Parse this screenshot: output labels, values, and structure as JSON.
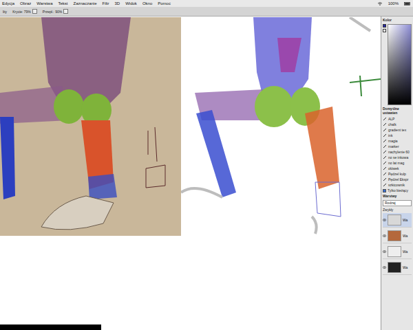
{
  "menu": [
    "Edycja",
    "Obraz",
    "Warstwa",
    "Tekst",
    "Zaznaczanie",
    "Filtr",
    "3D",
    "Widok",
    "Okno",
    "Pomoc"
  ],
  "status": {
    "zoom": "100%"
  },
  "options": {
    "mode": "lity",
    "opacity": "Krycie: 79%",
    "flow": "Przepł.: 90%"
  },
  "panel": {
    "color_title": "Kolor",
    "brush_title": "Domyślne ustawien",
    "brushes": [
      "ALP",
      "chalk",
      "gradient tex",
      "ink",
      "magia",
      "marker",
      "nachylenie 60",
      "no se inkowa",
      "no lat mag",
      "ołówek",
      "Pędzel kulp",
      "Pędzel Ekspr",
      "szkicownik"
    ],
    "current_tool_only": {
      "label": "Tylko bieżący",
      "checked": true
    },
    "layers_title": "Warstwy",
    "search": {
      "placeholder": "Rodzaj"
    },
    "blend": "Zwykły",
    "layers": [
      {
        "name": "Wa",
        "selected": true,
        "thumb": "#d8d8d8"
      },
      {
        "name": "Wa",
        "selected": false,
        "thumb": "#b4683c"
      },
      {
        "name": "Wa",
        "selected": false,
        "thumb": "#eeeeee"
      },
      {
        "name": "Wa",
        "selected": false,
        "thumb": "#222222"
      }
    ]
  }
}
